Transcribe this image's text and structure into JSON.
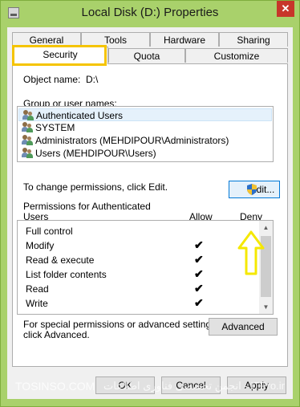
{
  "window": {
    "title": "Local Disk (D:) Properties",
    "close_glyph": "✕"
  },
  "tabs_row1": [
    {
      "label": "General"
    },
    {
      "label": "Tools"
    },
    {
      "label": "Hardware"
    },
    {
      "label": "Sharing"
    }
  ],
  "tabs_row2": [
    {
      "label": "Security",
      "active": true
    },
    {
      "label": "Quota"
    },
    {
      "label": "Customize"
    }
  ],
  "security": {
    "object_name_label": "Object name:",
    "object_name_value": "D:\\",
    "group_label": "Group or user names:",
    "users": [
      {
        "name": "Authenticated Users",
        "selected": true
      },
      {
        "name": "SYSTEM"
      },
      {
        "name": "Administrators (MEHDIPOUR\\Administrators)"
      },
      {
        "name": "Users (MEHDIPOUR\\Users)"
      }
    ],
    "change_text": "To change permissions, click Edit.",
    "edit_button": "Edit...",
    "permissions_for_line1": "Permissions for Authenticated",
    "permissions_for_line2": "Users",
    "allow_header": "Allow",
    "deny_header": "Deny",
    "permissions": [
      {
        "name": "Full control",
        "allow": false
      },
      {
        "name": "Modify",
        "allow": true
      },
      {
        "name": "Read & execute",
        "allow": true
      },
      {
        "name": "List folder contents",
        "allow": true
      },
      {
        "name": "Read",
        "allow": true
      },
      {
        "name": "Write",
        "allow": true
      }
    ],
    "check_glyph": "✔",
    "special_line1": "For special permissions or advanced settings,",
    "special_line2": "click Advanced.",
    "advanced_button": "Advanced"
  },
  "footer": {
    "ok_button": "OK",
    "cancel_button": "Cancel",
    "apply_button": "Apply"
  },
  "watermark": {
    "left": "TOSINSO.COM",
    "right": "انجمن تخصصی فناوری اطلاعات - ITPro.ir"
  },
  "colors": {
    "chrome": "#a9d16b",
    "highlight": "#f5c400",
    "close": "#c7362a"
  }
}
